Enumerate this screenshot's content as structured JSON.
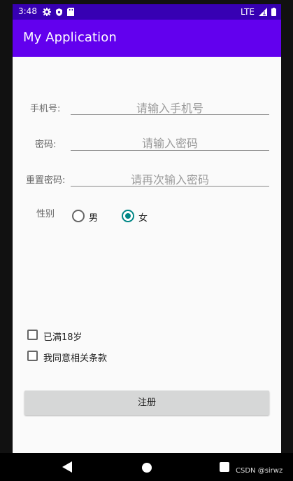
{
  "status_bar": {
    "time": "3:48",
    "network": "LTE",
    "left_icons": [
      "settings-icon",
      "shield-icon",
      "sd-card-icon"
    ],
    "right_icons": [
      "signal-icon",
      "battery-icon"
    ]
  },
  "app_bar": {
    "title": "My Application",
    "background_color": "#6200ee"
  },
  "form": {
    "phone": {
      "label": "手机号:",
      "placeholder": "请输入手机号"
    },
    "password": {
      "label": "密码:",
      "placeholder": "请输入密码"
    },
    "confirm_password": {
      "label": "重置密码:",
      "placeholder": "请再次输入密码"
    },
    "gender": {
      "label": "性别",
      "options": [
        {
          "label": "男",
          "selected": false
        },
        {
          "label": "女",
          "selected": true
        }
      ]
    },
    "checkboxes": [
      {
        "label": "已满18岁",
        "checked": false
      },
      {
        "label": "我同意相关条款",
        "checked": false
      }
    ],
    "submit_label": "注册"
  },
  "watermark": "CSDN @sirwz",
  "colors": {
    "status_bar": "#3700b3",
    "accent": "#018786",
    "button": "#d6d7d7"
  }
}
